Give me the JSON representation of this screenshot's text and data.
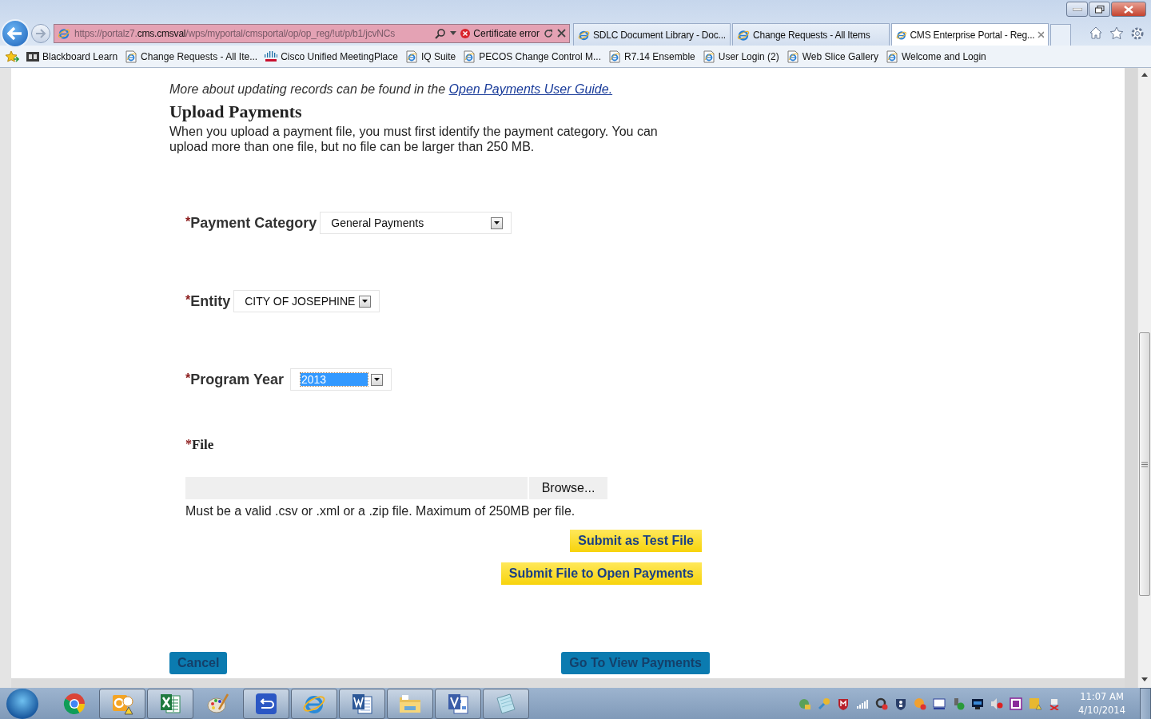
{
  "browser": {
    "address_bar": {
      "url_start": "https://portalz7.",
      "url_domain": "cms.cmsval",
      "url_end": "/wps/myportal/cmsportal/op/op_reg/!ut/p/b1/jcvNCs",
      "security": "Certificate error"
    },
    "tabs": [
      {
        "title": "SDLC Document Library - Doc...",
        "selected": false
      },
      {
        "title": "Change Requests - All Items",
        "selected": false
      },
      {
        "title": "CMS Enterprise Portal - Reg...",
        "selected": true
      }
    ],
    "favorites": [
      {
        "label": "Blackboard Learn",
        "kind": "blackboard"
      },
      {
        "label": "Change Requests - All Ite...",
        "kind": "page"
      },
      {
        "label": "Cisco Unified MeetingPlace",
        "kind": "cisco"
      },
      {
        "label": "IQ Suite",
        "kind": "page"
      },
      {
        "label": "PECOS Change Control M...",
        "kind": "page"
      },
      {
        "label": "R7.14 Ensemble",
        "kind": "page"
      },
      {
        "label": "User Login (2)",
        "kind": "page"
      },
      {
        "label": "Web Slice Gallery",
        "kind": "page"
      },
      {
        "label": "Welcome and Login",
        "kind": "page"
      }
    ]
  },
  "page": {
    "intro": "More about updating records can be found in the",
    "intro_link": "Open Payments User Guide.",
    "heading": "Upload Payments",
    "description": "When you upload a payment file, you must first identify the payment category. You can upload more than one file, but no file can be larger than 250 MB.",
    "fields": [
      {
        "marker": "*",
        "label": "Payment Category",
        "value": "General Payments",
        "focused": false
      },
      {
        "marker": "*",
        "label": "Entity",
        "value": "CITY OF JOSEPHINE",
        "focused": false
      },
      {
        "marker": "*",
        "label": "Program Year",
        "value": "2013",
        "focused": true
      }
    ],
    "file": {
      "marker": "*",
      "label": "File",
      "browse": "Browse...",
      "hint": "Must be a valid .csv or .xml or a .zip file. Maximum of 250MB per file."
    },
    "submit_buttons": [
      "Submit as Test File",
      "Submit File to Open Payments"
    ],
    "cancel": "Cancel",
    "view": "Go To View Payments"
  },
  "taskbar": {
    "apps": [
      {
        "kind": "chrome",
        "running": false
      },
      {
        "kind": "outlook",
        "running": true
      },
      {
        "kind": "excel",
        "running": true
      },
      {
        "kind": "paint",
        "running": false
      },
      {
        "kind": "loop",
        "running": true
      },
      {
        "kind": "ie",
        "running": true
      },
      {
        "kind": "word",
        "running": true
      },
      {
        "kind": "explorer",
        "running": true
      },
      {
        "kind": "visio",
        "running": true
      },
      {
        "kind": "notepad",
        "running": true
      }
    ],
    "clock": {
      "time": "11:07 AM",
      "date": "4/10/2014"
    }
  }
}
